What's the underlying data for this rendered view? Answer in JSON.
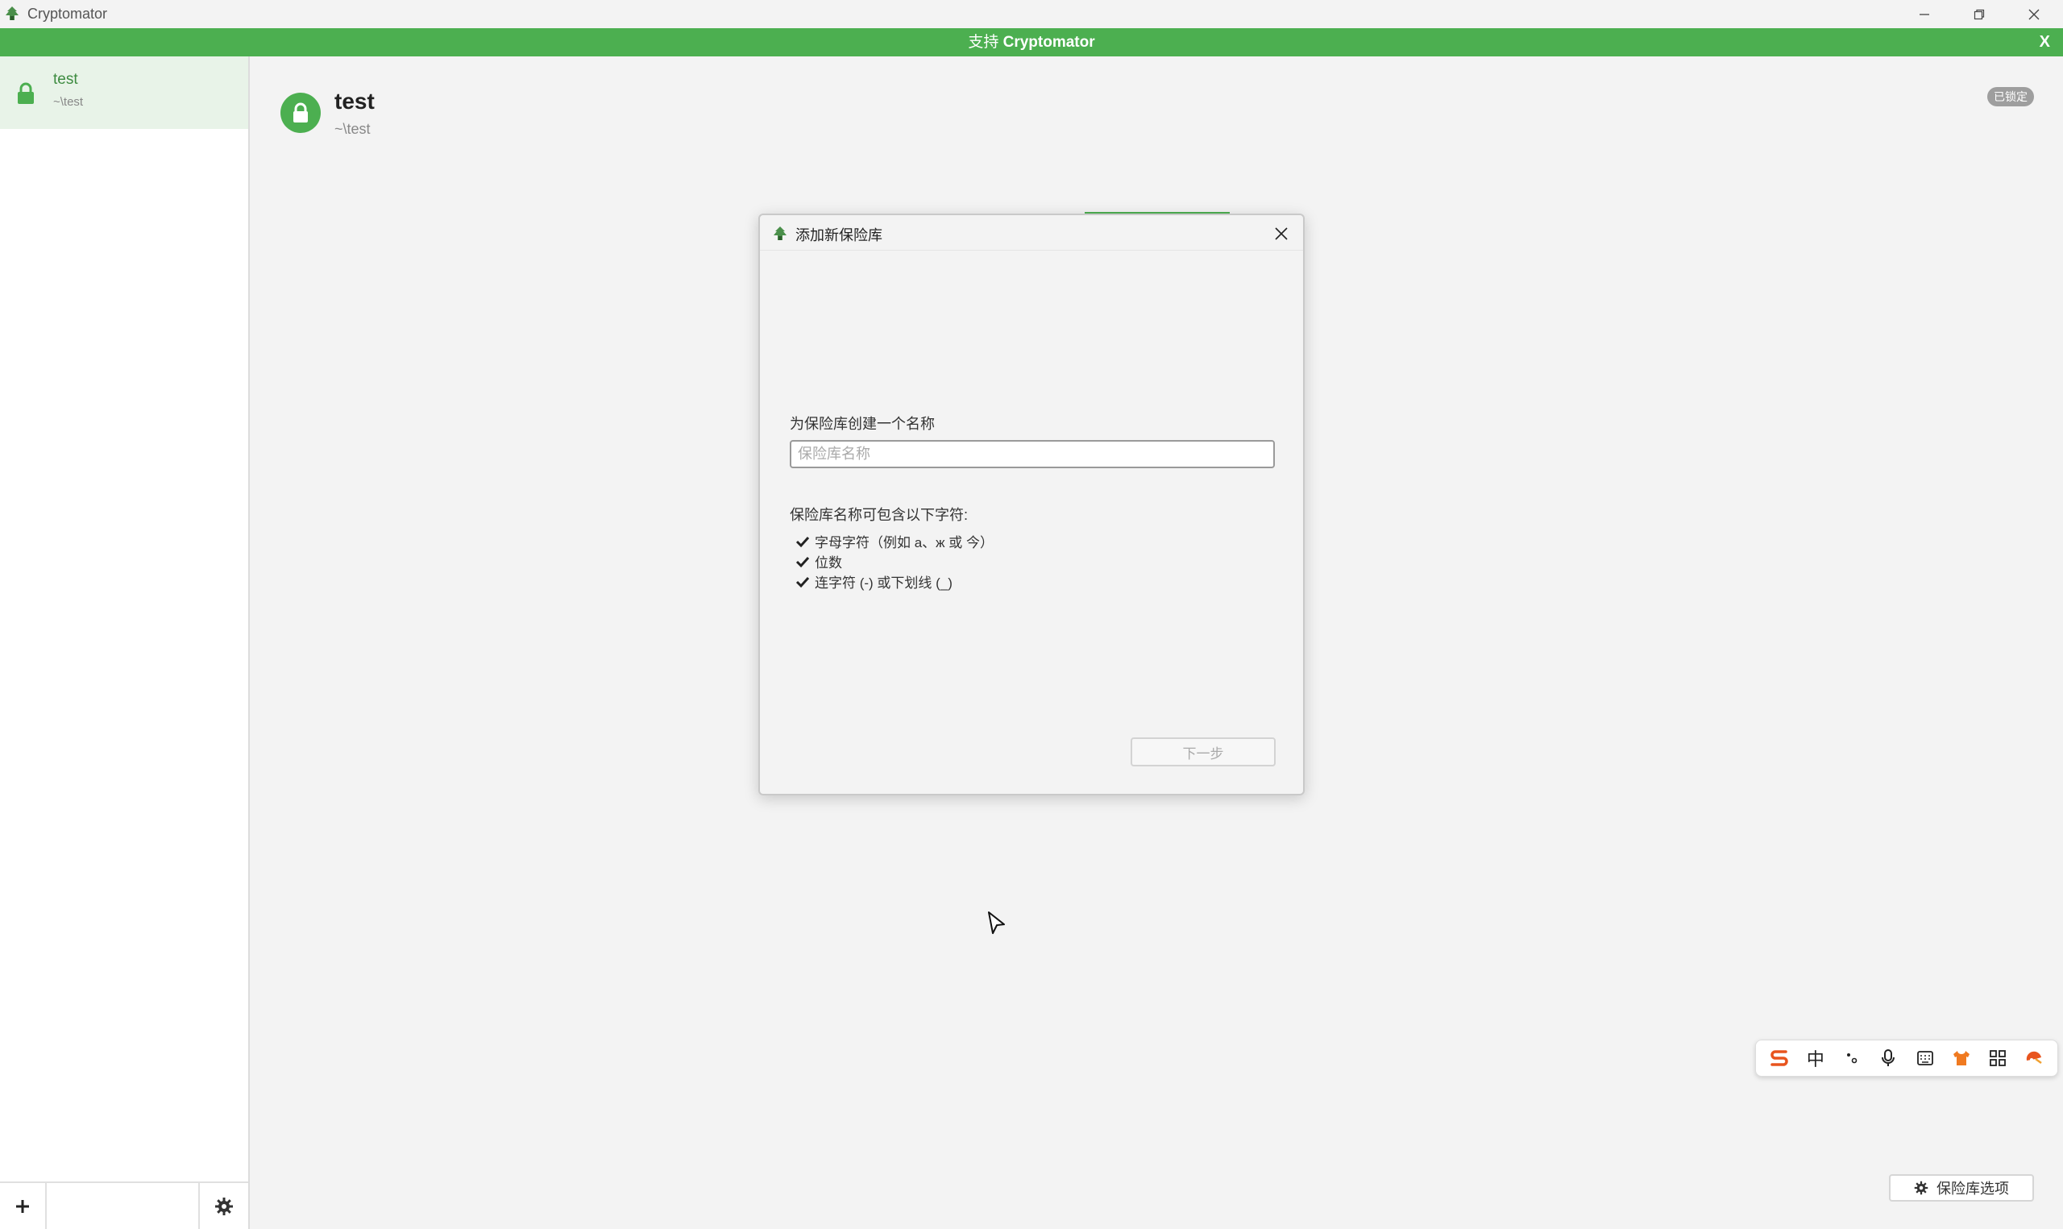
{
  "window": {
    "title": "Cryptomator",
    "controls": {
      "minimize_icon": "minimize-icon",
      "restore_icon": "restore-icon",
      "close_icon": "close-icon"
    }
  },
  "banner": {
    "prefix": "支持 ",
    "brand": "Cryptomator",
    "close_label": "X",
    "color": "#4caf50"
  },
  "sidebar": {
    "items": [
      {
        "name": "test",
        "path": "~\\test",
        "icon": "lock-icon"
      }
    ],
    "add_icon": "plus-icon",
    "settings_icon": "gear-icon"
  },
  "main": {
    "vault_name": "test",
    "vault_path": "~\\test",
    "status_badge": "已锁定",
    "vault_options_label": "保险库选项"
  },
  "dialog": {
    "title": "添加新保险库",
    "name_label": "为保险库创建一个名称",
    "name_placeholder": "保险库名称",
    "name_value": "",
    "allowed_heading": "保险库名称可包含以下字符:",
    "rules": [
      "字母字符（例如 a、ж 或 今）",
      "位数",
      "连字符 (-) 或下划线 (_)"
    ],
    "next_label": "下一步"
  },
  "ime_toolbar": {
    "items": [
      "sogou-logo-icon",
      "中",
      "punctuation-icon",
      "microphone-icon",
      "keyboard-icon",
      "skin-icon",
      "grid-icon",
      "tools-icon"
    ],
    "mode_label": "中"
  },
  "colors": {
    "accent": "#4caf50",
    "accent_dark": "#3d8b40",
    "badge": "#9e9e9e"
  }
}
